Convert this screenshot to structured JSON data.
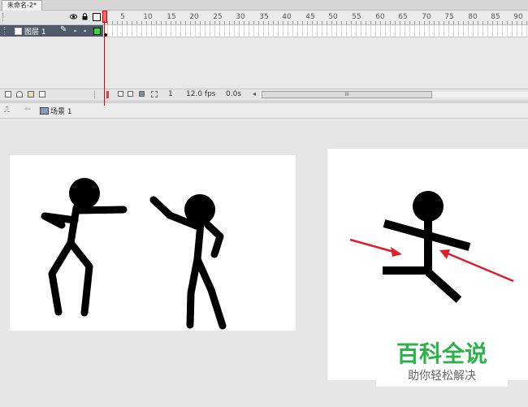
{
  "document_tab": {
    "title": "未命名-2*"
  },
  "timeline": {
    "header": {
      "eye_icon": "eye-icon",
      "lock_icon": "lock-icon",
      "outline_icon": "outline-square-icon",
      "frame_ticks": [
        "5",
        "10",
        "15",
        "20",
        "25",
        "30",
        "35",
        "40",
        "45",
        "50",
        "55",
        "60",
        "65",
        "70",
        "75",
        "80",
        "85",
        "90"
      ]
    },
    "layers": [
      {
        "name": "图层 1",
        "color": "#30e030"
      }
    ],
    "footer": {
      "current_frame": "1",
      "frame_rate": "12.0 fps",
      "elapsed_time": "0.0s",
      "scroll_arrow": "◂",
      "scroll_thumb_grip": "III"
    }
  },
  "edit_bar": {
    "scene_label": "场景 1",
    "back_arrow": "⇐"
  },
  "stage": {
    "background": "#ffffff",
    "figure_color": "#000000",
    "arrow_color": "#dd1f2a"
  },
  "watermark": {
    "brand": "百科全说",
    "tagline": "助你轻松解决",
    "brand_color": "#2bb34a"
  }
}
